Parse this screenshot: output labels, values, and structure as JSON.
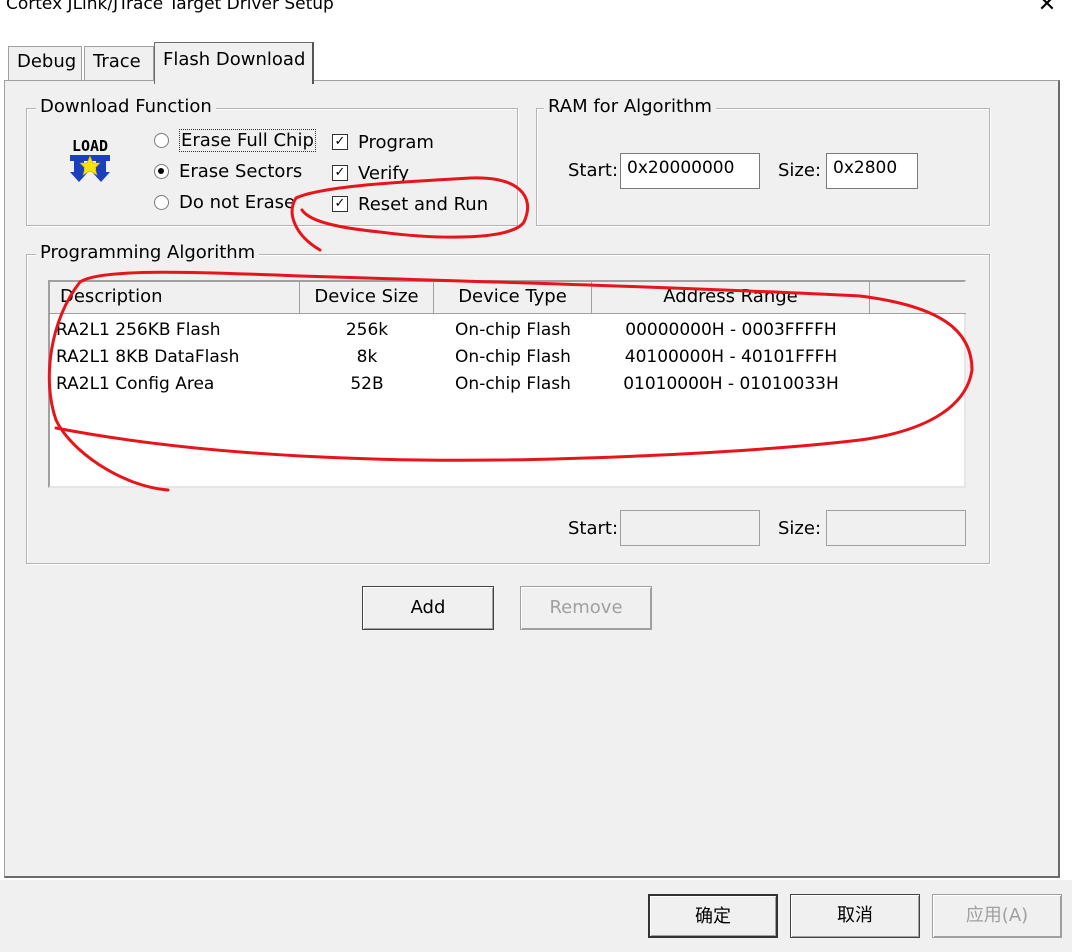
{
  "window": {
    "title": "Cortex JLink/JTrace Target Driver Setup",
    "close_icon": "close-icon"
  },
  "tabs": [
    {
      "label": "Debug"
    },
    {
      "label": "Trace"
    },
    {
      "label": "Flash Download",
      "active": true
    }
  ],
  "download_function": {
    "legend": "Download Function",
    "icon_text": "LOAD",
    "radios": [
      {
        "label": "Erase Full Chip",
        "selected": false
      },
      {
        "label": "Erase Sectors",
        "selected": true
      },
      {
        "label": "Do not Erase",
        "selected": false
      }
    ],
    "checks": [
      {
        "label": "Program",
        "checked": true
      },
      {
        "label": "Verify",
        "checked": true
      },
      {
        "label": "Reset and Run",
        "checked": true
      }
    ]
  },
  "ram": {
    "legend": "RAM for Algorithm",
    "start_label": "Start:",
    "start_value": "0x20000000",
    "size_label": "Size:",
    "size_value": "0x2800"
  },
  "algorithm": {
    "legend": "Programming Algorithm",
    "columns": [
      "Description",
      "Device Size",
      "Device Type",
      "Address Range"
    ],
    "rows": [
      [
        "RA2L1 256KB Flash",
        "256k",
        "On-chip Flash",
        "00000000H - 0003FFFFH"
      ],
      [
        "RA2L1 8KB DataFlash",
        "8k",
        "On-chip Flash",
        "40100000H - 40101FFFH"
      ],
      [
        "RA2L1 Config Area",
        "52B",
        "On-chip Flash",
        "01010000H - 01010033H"
      ]
    ],
    "start_label": "Start:",
    "start_value": "",
    "size_label": "Size:",
    "size_value": ""
  },
  "buttons": {
    "add": "Add",
    "remove": "Remove"
  },
  "footer": {
    "ok": "确定",
    "cancel": "取消",
    "apply": "应用(A)"
  },
  "colors": {
    "annotation": "#e8141b",
    "dialog_bg": "#f0f0f0"
  }
}
